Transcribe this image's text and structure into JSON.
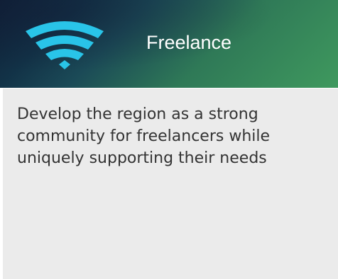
{
  "header": {
    "title": "Freelance",
    "icon": "wifi-icon",
    "icon_color": "#29c4e8"
  },
  "content": {
    "text": "Develop the region as a strong community for freelancers while uniquely supporting their needs"
  },
  "colors": {
    "header_gradient_start": "#0f2037",
    "header_gradient_end": "#3f995e",
    "panel_background": "#ebebeb",
    "text": "#333333"
  }
}
